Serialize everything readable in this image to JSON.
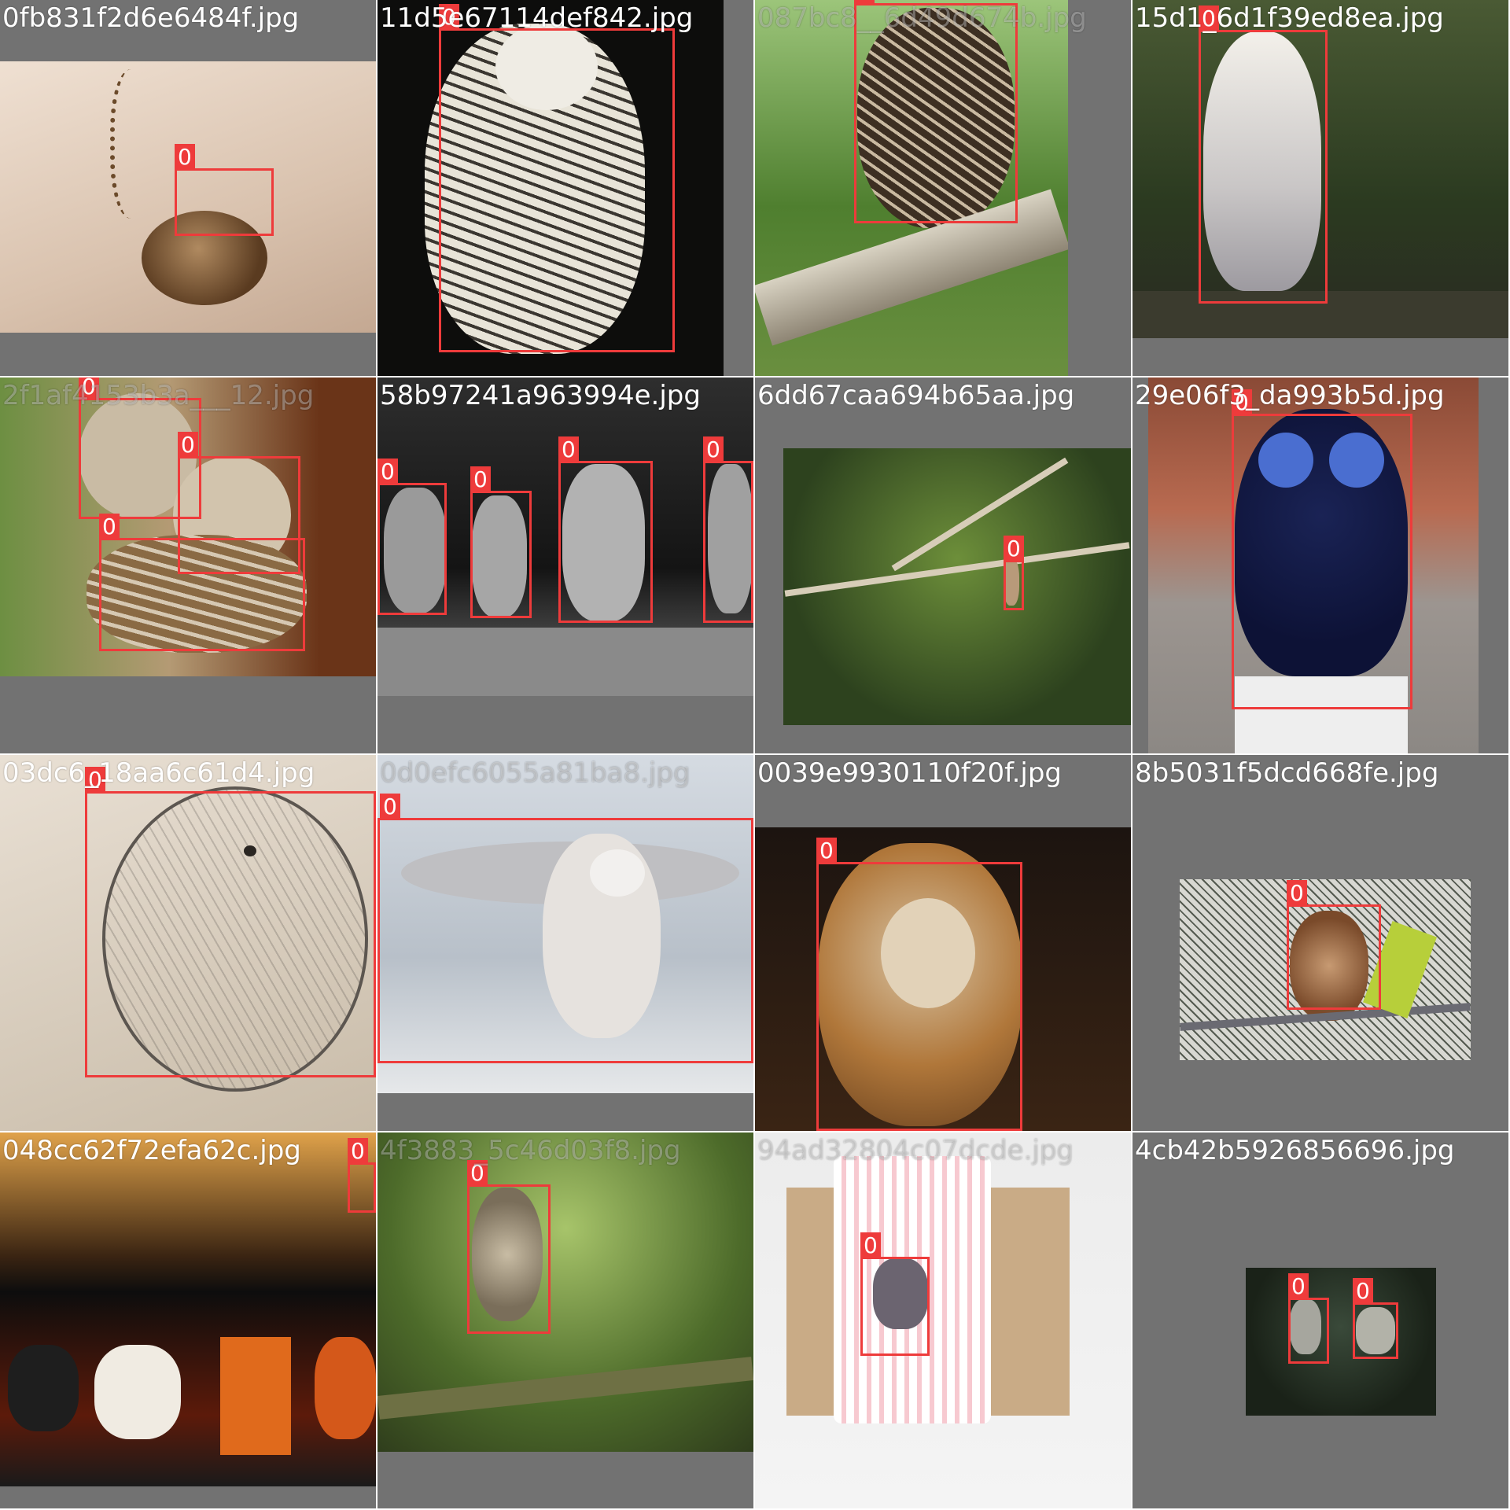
{
  "class_label": "0",
  "box_color": "#ee3b3b",
  "tiles": [
    {
      "filename": "0fb831f2d6e6484f.jpg",
      "subject": "owl pendant locket on chain"
    },
    {
      "filename": "11d5e67114def842.jpg",
      "subject": "snowy owl"
    },
    {
      "filename": "087bc8__6d49d674b.jpg",
      "subject": "owl perched on mossy branch"
    },
    {
      "filename": "15d1_6d1f39ed8ea.jpg",
      "subject": "barn owl on post"
    },
    {
      "filename": "2f1af4153b3a___12.jpg",
      "subject": "three owlets"
    },
    {
      "filename": "58b97241a963994e.jpg",
      "subject": "four owls on a log, black and white"
    },
    {
      "filename": "6dd67caa694b65aa.jpg",
      "subject": "owl in tree branches"
    },
    {
      "filename": "29e06f3_da993b5d.jpg",
      "subject": "painted owl statue"
    },
    {
      "filename": "03dc6_18aa6c61d4.jpg",
      "subject": "pencil drawing of barn owl"
    },
    {
      "filename": "0d0efc6055a81ba8.jpg",
      "subject": "barn owl spreading wings"
    },
    {
      "filename": "0039e9930110f20f.jpg",
      "subject": "barn owl close-up"
    },
    {
      "filename": "8b5031f5dcd668fe.jpg",
      "subject": "screech owl in enclosure"
    },
    {
      "filename": "048cc62f72efa62c.jpg",
      "subject": "halloween decorations shelf"
    },
    {
      "filename": "4f3883_5c46d03f8.jpg",
      "subject": "owlet in tree"
    },
    {
      "filename": "94ad32804c07dcde.jpg",
      "subject": "gift tag with owl sticker"
    },
    {
      "filename": "4cb42b5926856696.jpg",
      "subject": "two owls in tree"
    }
  ]
}
